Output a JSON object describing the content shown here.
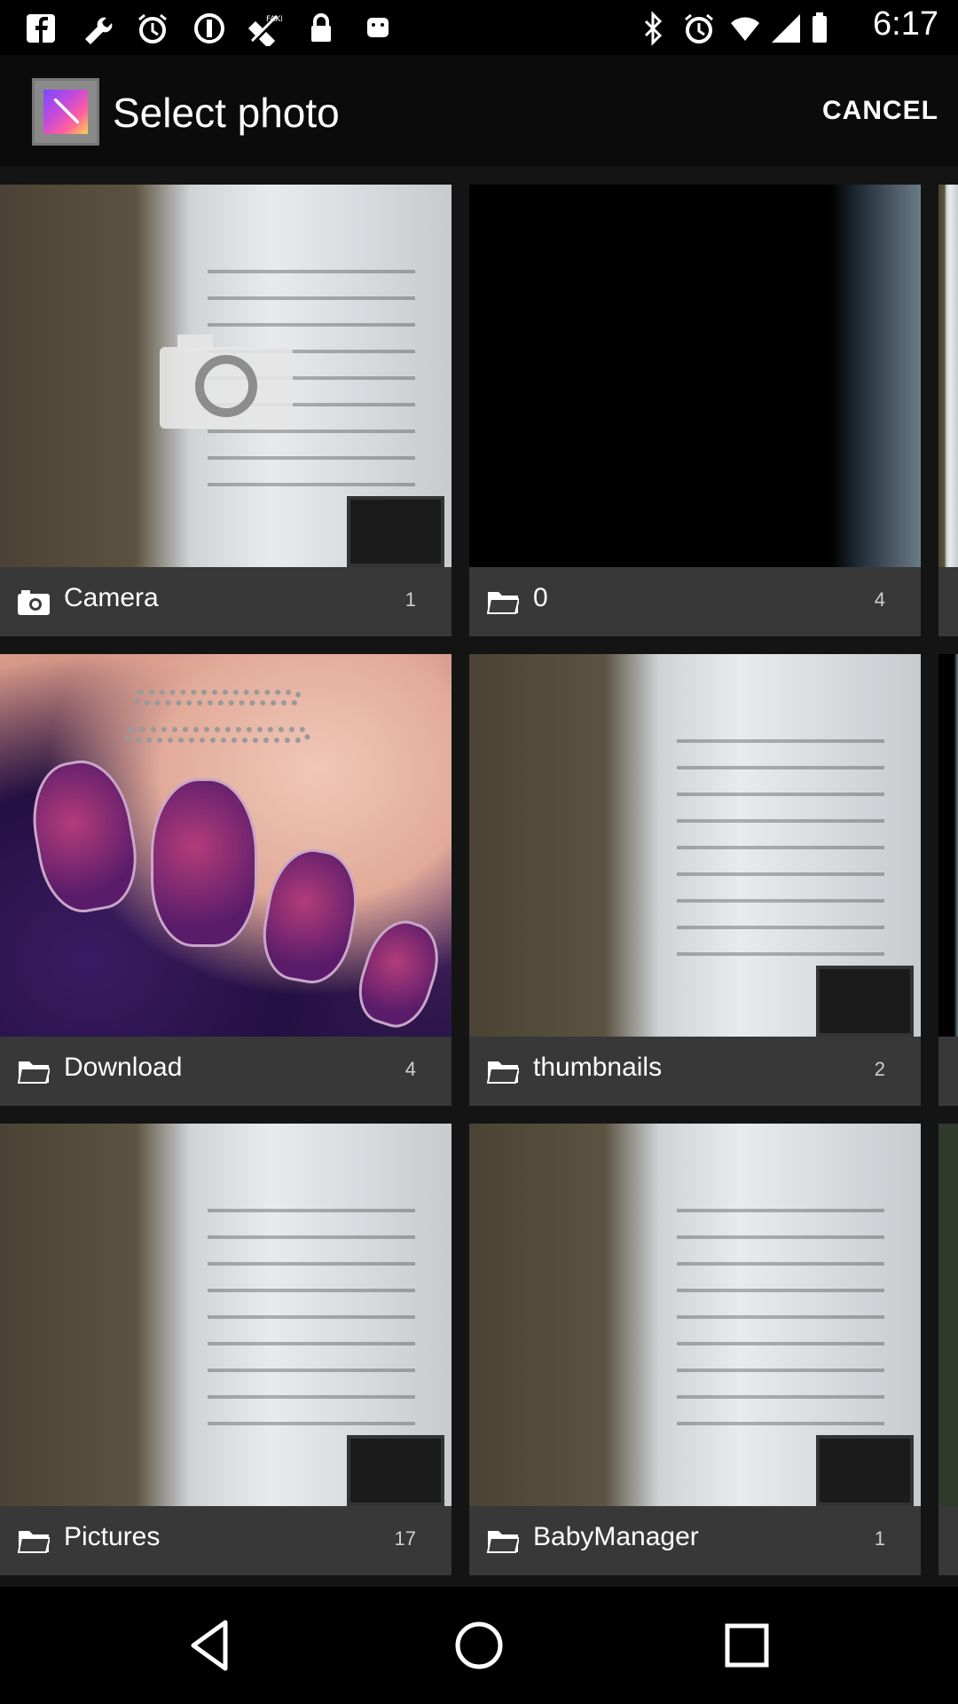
{
  "status_bar": {
    "time": "6:17",
    "left_icons": [
      "facebook-icon",
      "wrench-icon",
      "alarm-icon",
      "circle-status-icon",
      "fake-gps-icon",
      "lock-icon",
      "android-icon"
    ],
    "right_icons": [
      "bluetooth-icon",
      "alarm-icon"
    ]
  },
  "action_bar": {
    "title": "Select photo",
    "cancel_label": "CANCEL"
  },
  "albums": [
    {
      "name": "Camera",
      "count": "1",
      "icon": "camera-icon"
    },
    {
      "name": "0",
      "count": "4",
      "icon": "folder-icon"
    },
    {
      "name": "Download",
      "count": "4",
      "icon": "folder-icon"
    },
    {
      "name": "thumbnails",
      "count": "2",
      "icon": "folder-icon"
    },
    {
      "name": "Pictures",
      "count": "17",
      "icon": "folder-icon"
    },
    {
      "name": "BabyManager",
      "count": "1",
      "icon": "folder-icon"
    }
  ],
  "nav_bar": {
    "buttons": [
      "back-icon",
      "home-icon",
      "recents-icon"
    ]
  },
  "colors": {
    "background": "#000000",
    "label_bar": "#3c3c3c",
    "text": "#ffffff"
  }
}
